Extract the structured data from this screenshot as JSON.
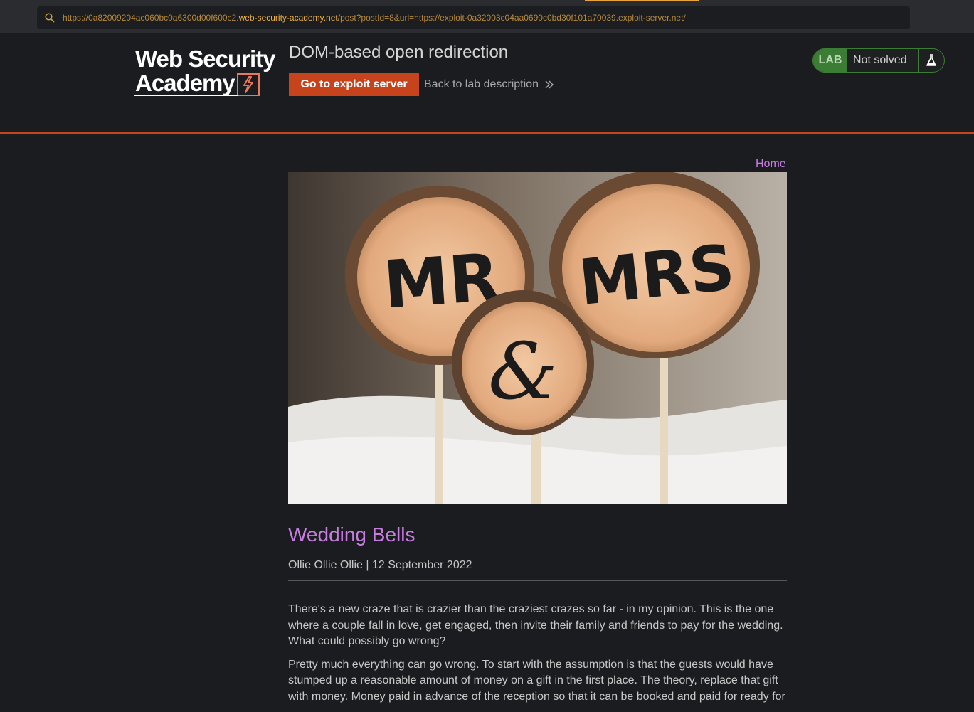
{
  "browser": {
    "url_prefix": "https://0a82009204ac060bc0a6300d00f600c2.",
    "url_host": "web-security-academy.net",
    "url_path": "/post?postId=8&url=https://exploit-0a32003c04aa0690c0bd30f101a70039.exploit-server.net/"
  },
  "header": {
    "logo_line1": "Web Security",
    "logo_line2": "Academy",
    "lab_title": "DOM-based open redirection",
    "exploit_button": "Go to exploit server",
    "back_link": "Back to lab description",
    "lab_badge": {
      "tag": "LAB",
      "status": "Not solved"
    }
  },
  "nav": {
    "home": "Home"
  },
  "post": {
    "title": "Wedding Bells",
    "meta": "Ollie Ollie Ollie | 12 September 2022",
    "image_subject": "wooden cake toppers MR & MRS",
    "paragraphs": [
      "There's a new craze that is crazier than the craziest crazes so far - in my opinion. This is the one where a couple fall in love, get engaged, then invite their family and friends to pay for the wedding. What could possibly go wrong?",
      "Pretty much everything can go wrong. To start with the assumption is that the guests would have stumped up a reasonable amount of money on a gift in the first place. The theory, replace that gift with money. Money paid in advance of the reception so that it can be booked and paid for ready for"
    ]
  },
  "colors": {
    "accent": "#c7431b",
    "link": "#c77ee0",
    "lab_green": "#3c7d35",
    "url_host": "#f1b344"
  }
}
